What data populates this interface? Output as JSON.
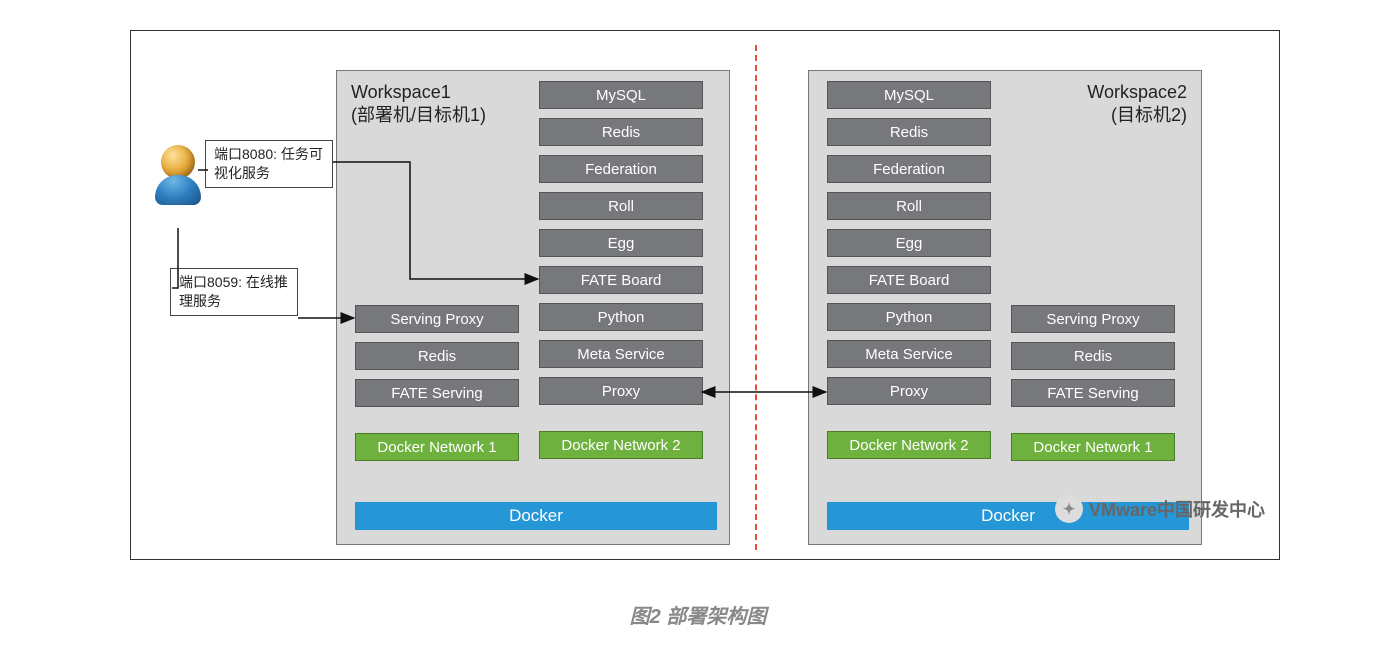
{
  "caption": "图2 部署架构图",
  "annotations": {
    "port8080": "端口8080: 任务可视化服务",
    "port8059": "端口8059: 在线推理服务"
  },
  "workspace1": {
    "title": "Workspace1\n(部署机/目标机1)",
    "left_column": [
      "Serving Proxy",
      "Redis",
      "FATE Serving"
    ],
    "right_column": [
      "MySQL",
      "Redis",
      "Federation",
      "Roll",
      "Egg",
      "FATE Board",
      "Python",
      "Meta Service",
      "Proxy"
    ],
    "net_left": "Docker Network 1",
    "net_right": "Docker Network 2",
    "docker": "Docker"
  },
  "workspace2": {
    "title": "Workspace2\n(目标机2)",
    "left_column": [
      "MySQL",
      "Redis",
      "Federation",
      "Roll",
      "Egg",
      "FATE Board",
      "Python",
      "Meta Service",
      "Proxy"
    ],
    "right_column": [
      "Serving Proxy",
      "Redis",
      "FATE Serving"
    ],
    "net_left": "Docker Network 2",
    "net_right": "Docker Network 1",
    "docker": "Docker"
  },
  "watermark": "VMware中国研发中心"
}
